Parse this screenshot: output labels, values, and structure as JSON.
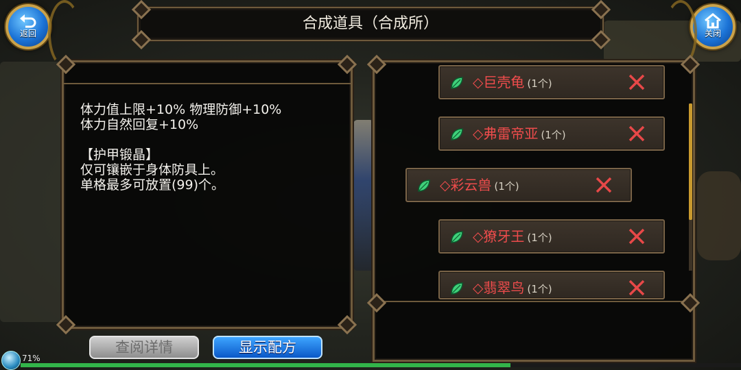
{
  "title": "合成道具（合成所）",
  "back_button": {
    "label": "返回"
  },
  "close_button": {
    "label": "关闭"
  },
  "description": [
    "体力值上限+10% 物理防御+10%",
    "体力自然回复+10%",
    "",
    "【护甲锻晶】",
    "仅可镶嵌于身体防具上。",
    "单格最多可放置(99)个。"
  ],
  "items": [
    {
      "name": "◇巨壳龟",
      "count": "(1个)"
    },
    {
      "name": "◇弗雷帝亚",
      "count": "(1个)"
    },
    {
      "name": "◇彩云兽",
      "count": "(1个)"
    },
    {
      "name": "◇獠牙王",
      "count": "(1个)"
    },
    {
      "name": "◇翡翠鸟",
      "count": "(1个)"
    }
  ],
  "buttons": {
    "view_details": "查阅详情",
    "show_recipe": "显示配方"
  },
  "status": {
    "battery": "71%"
  },
  "exp_progress": 0.68,
  "colors": {
    "item_name": "#ee4c4c",
    "accent_blue": "#1b73d6",
    "frame_gold": "#caa24a"
  }
}
